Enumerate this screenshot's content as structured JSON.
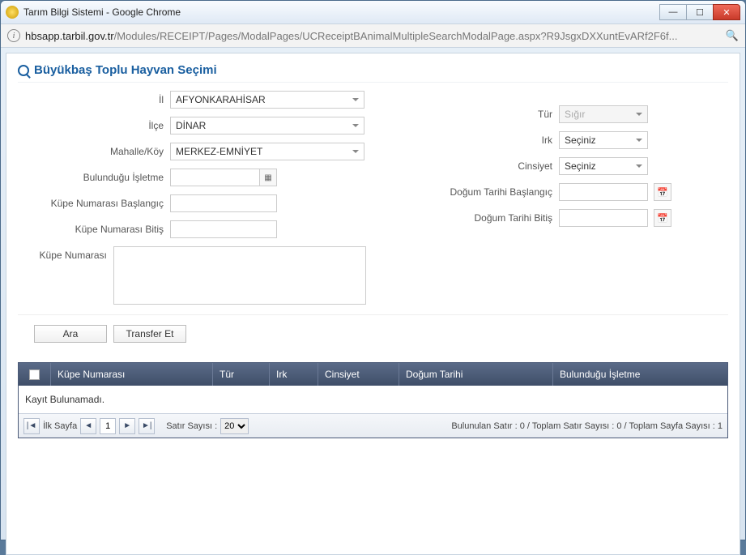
{
  "window": {
    "title": "Tarım Bilgi Sistemi - Google Chrome"
  },
  "address": {
    "host": "hbsapp.tarbil.gov.tr",
    "path": "/Modules/RECEIPT/Pages/ModalPages/UCReceiptBAnimalMultipleSearchModalPage.aspx?R9JsgxDXXuntEvARf2F6f..."
  },
  "page": {
    "title": "Büyükbaş Toplu Hayvan Seçimi"
  },
  "form": {
    "left": {
      "il_label": "İl",
      "il_value": "AFYONKARAHİSAR",
      "ilce_label": "İlçe",
      "ilce_value": "DİNAR",
      "mahalle_label": "Mahalle/Köy",
      "mahalle_value": "MERKEZ-EMNİYET",
      "isletme_label": "Bulunduğu İşletme",
      "isletme_value": "",
      "kupe_bas_label": "Küpe Numarası Başlangıç",
      "kupe_bas_value": "",
      "kupe_bit_label": "Küpe Numarası Bitiş",
      "kupe_bit_value": "",
      "kupe_label": "Küpe Numarası"
    },
    "right": {
      "tur_label": "Tür",
      "tur_value": "Sığır",
      "irk_label": "Irk",
      "irk_value": "Seçiniz",
      "cins_label": "Cinsiyet",
      "cins_value": "Seçiniz",
      "dog_bas_label": "Doğum Tarihi Başlangıç",
      "dog_bas_value": "",
      "dog_bit_label": "Doğum Tarihi Bitiş",
      "dog_bit_value": ""
    }
  },
  "buttons": {
    "ara": "Ara",
    "transfer": "Transfer Et"
  },
  "grid": {
    "columns": {
      "kupe": "Küpe Numarası",
      "tur": "Tür",
      "irk": "Irk",
      "cinsiyet": "Cinsiyet",
      "dogum": "Doğum Tarihi",
      "isletme": "Bulunduğu İşletme"
    },
    "empty": "Kayıt Bulunamadı."
  },
  "pager": {
    "first_label": "İlk Sayfa",
    "page_number": "1",
    "row_count_label": "Satır Sayısı :",
    "row_count_value": "20",
    "info": "Bulunulan Satır : 0 / Toplam Satır Sayısı : 0 / Toplam Sayfa Sayısı : 1"
  }
}
